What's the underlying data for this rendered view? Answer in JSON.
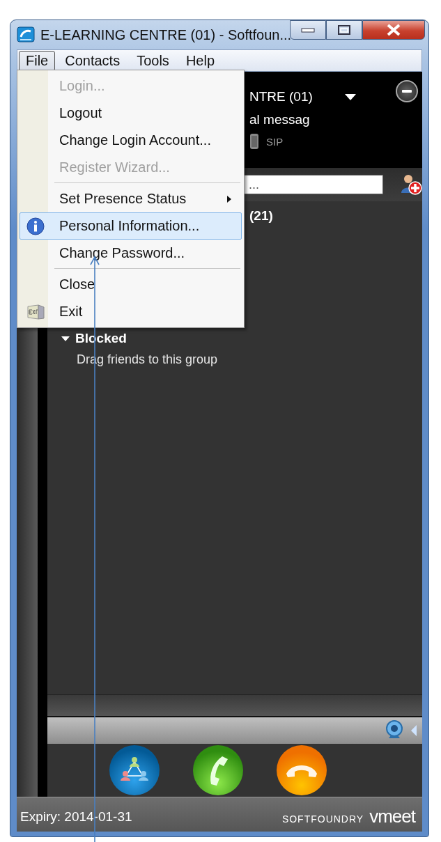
{
  "window": {
    "title": "E-LEARNING CENTRE (01) - Softfoun..."
  },
  "menubar": [
    {
      "label": "File",
      "selected": true
    },
    {
      "label": "Contacts",
      "selected": false
    },
    {
      "label": "Tools",
      "selected": false
    },
    {
      "label": "Help",
      "selected": false
    }
  ],
  "file_menu": [
    {
      "kind": "item",
      "label": "Login...",
      "disabled": true,
      "selected": false
    },
    {
      "kind": "item",
      "label": "Logout",
      "disabled": false,
      "selected": false
    },
    {
      "kind": "item",
      "label": "Change Login Account...",
      "disabled": false,
      "selected": false
    },
    {
      "kind": "item",
      "label": "Register Wizard...",
      "disabled": true,
      "selected": false
    },
    {
      "kind": "separator"
    },
    {
      "kind": "submenu",
      "label": "Set Presence Status",
      "disabled": false,
      "selected": false
    },
    {
      "kind": "item",
      "label": "Personal Information...",
      "disabled": false,
      "selected": true
    },
    {
      "kind": "item",
      "label": "Change Password...",
      "disabled": false,
      "selected": false
    },
    {
      "kind": "separator"
    },
    {
      "kind": "item",
      "label": "Close",
      "disabled": false,
      "selected": false
    },
    {
      "kind": "item",
      "label": "Exit",
      "disabled": false,
      "selected": false
    }
  ],
  "profile": {
    "name": "NTRE (01)",
    "message": "al messag",
    "service": "SIP"
  },
  "search": {
    "placeholder": "..."
  },
  "groups": [
    {
      "label": "(21)"
    },
    {
      "label": "Blocked",
      "expanded": true,
      "hint": "Drag friends to this group"
    }
  ],
  "status_bar": {
    "expiry": "Expiry: 2014-01-31",
    "brand": "SOFTFOUNDRY",
    "product": "vmeet"
  }
}
